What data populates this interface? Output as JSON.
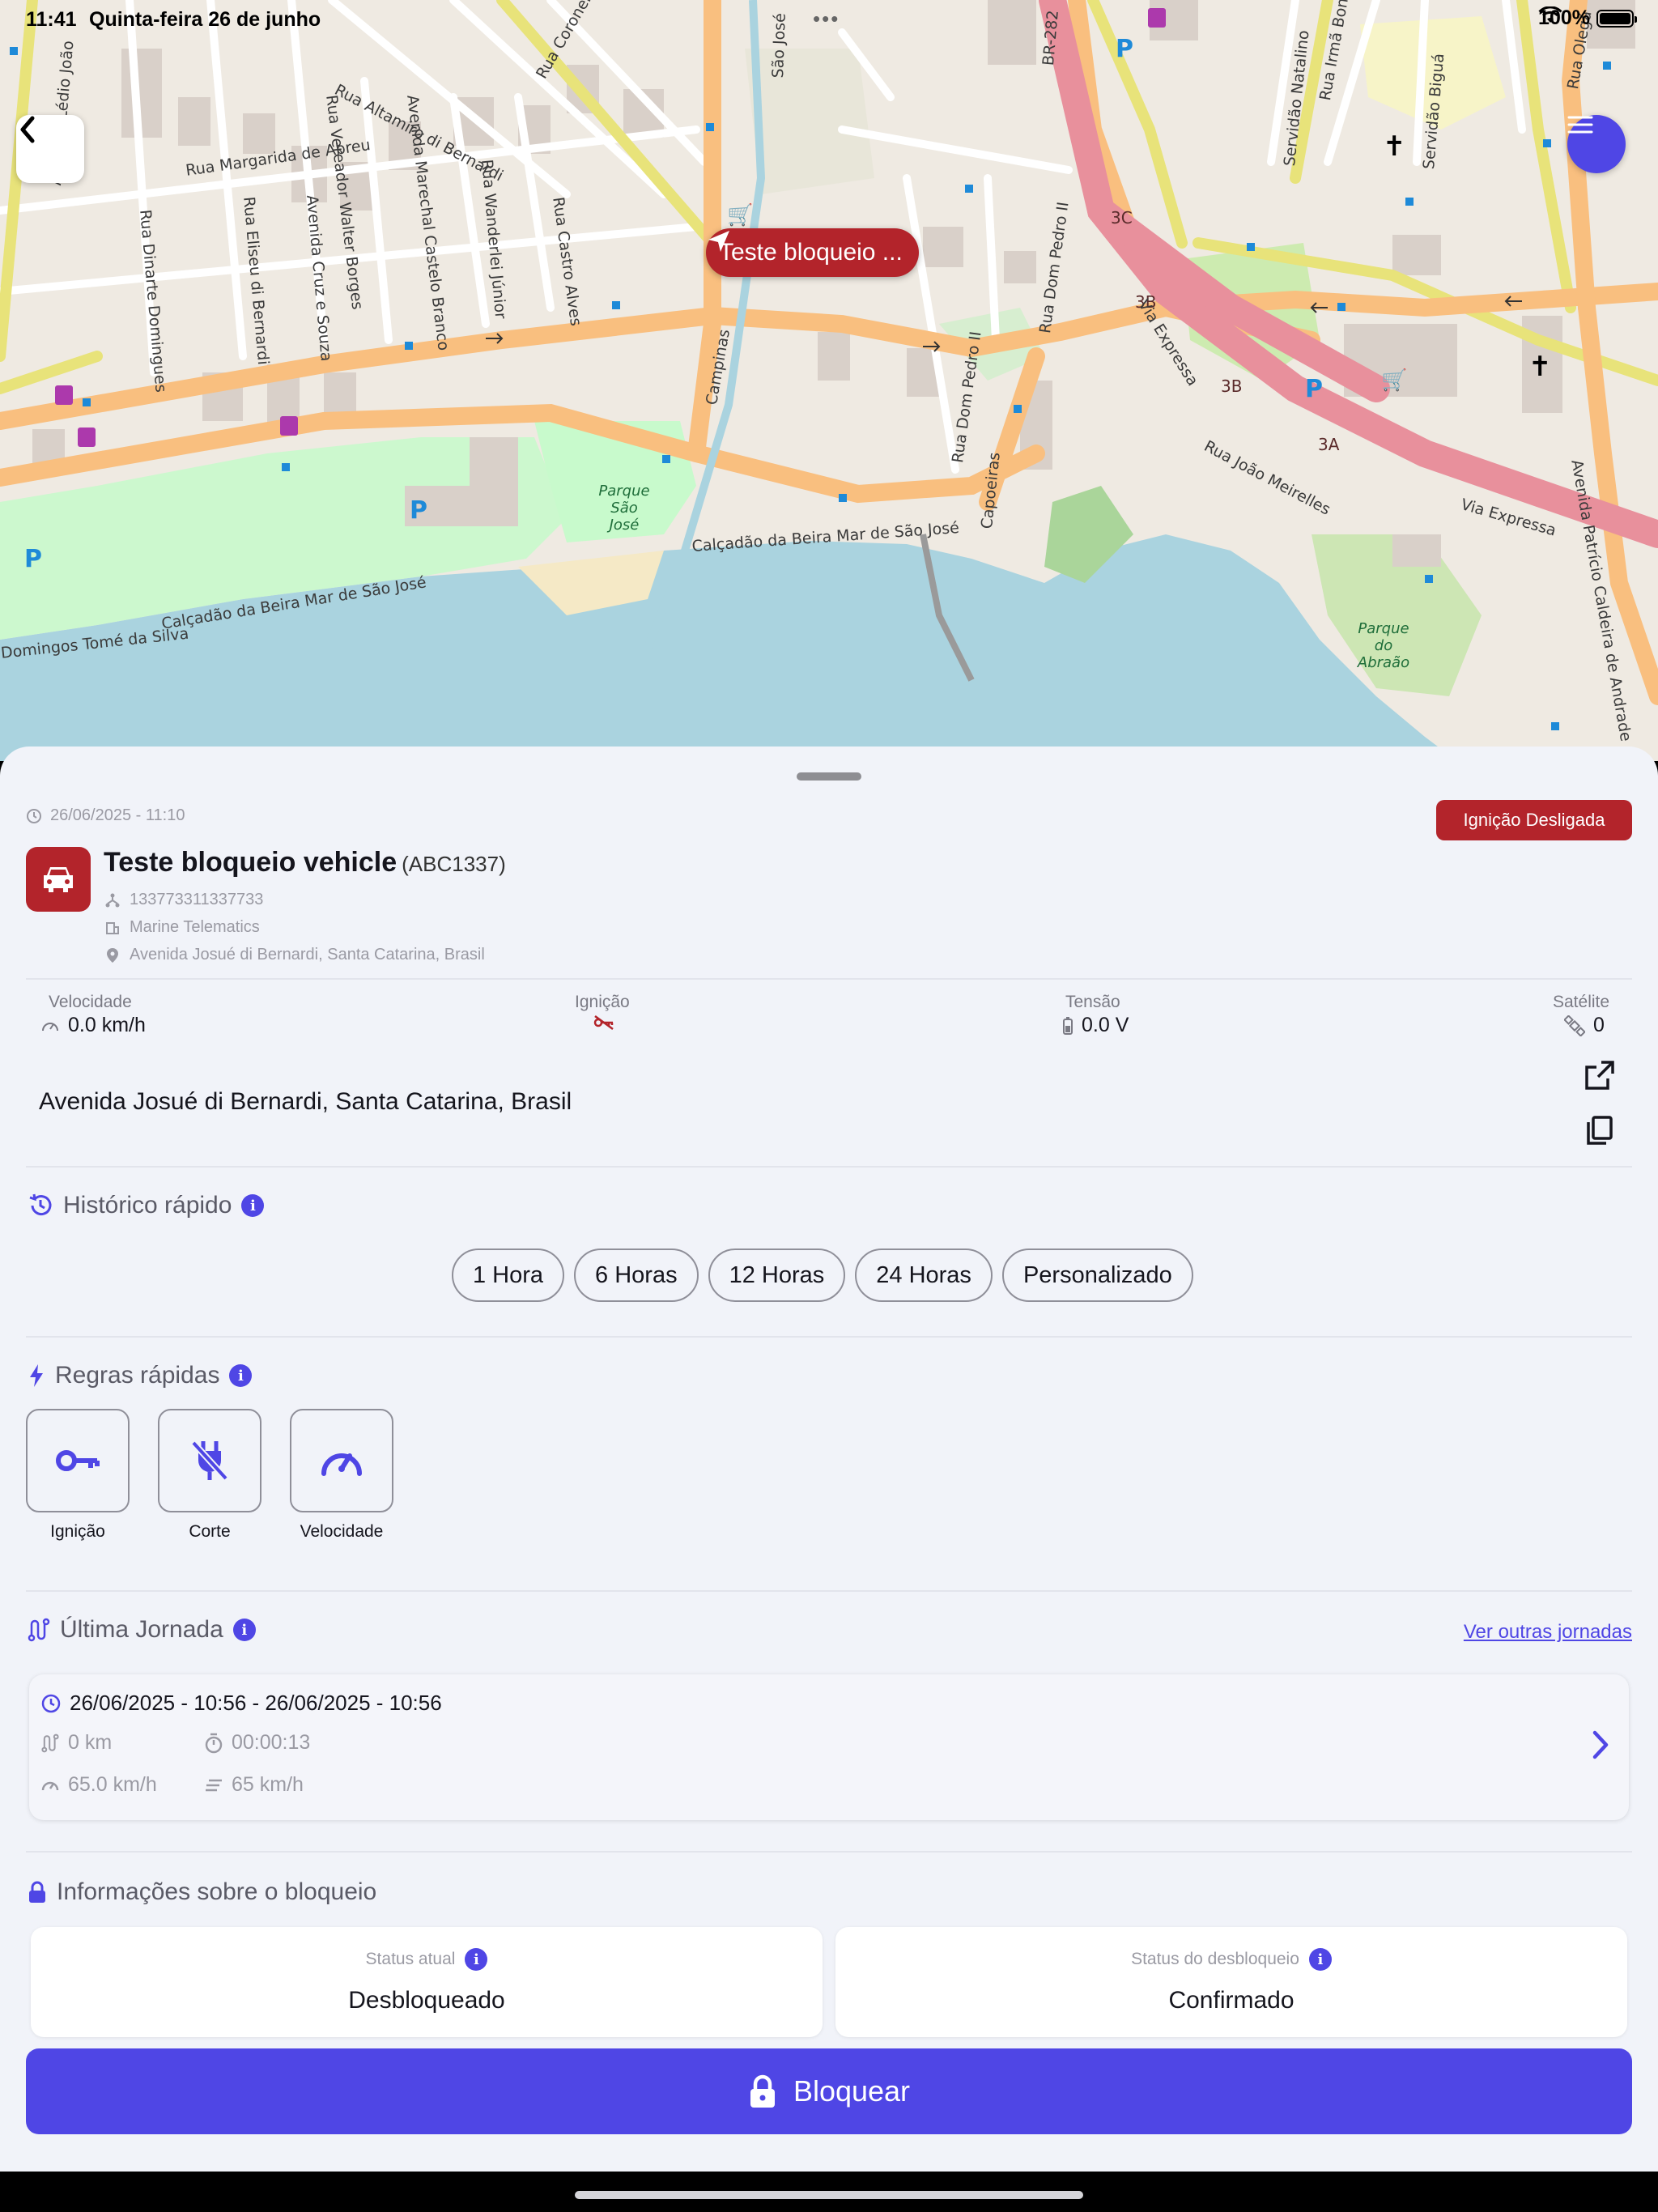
{
  "status_bar": {
    "time": "11:41",
    "date": "Quinta-feira 26 de junho",
    "battery": "100%"
  },
  "map": {
    "marker_label": "Teste bloqueio ...",
    "street_labels": [
      "Rua Altamiro di Bernardi",
      "Rua Margarida de Abreu",
      "Rua Vereador Walter Borges",
      "Avenida Marechal Castelo Branco",
      "Rua Wanderlei Júnior",
      "Rua Castro Alves",
      "Rua Coronel",
      "Rua Eliseu di Bernardi",
      "Avenida Cruz e Souza",
      "Rua Dinarte Domingues",
      "Avenida Lédio João",
      "Via Expressa",
      "Rua João Meirelles",
      "Rua Dom Pedro II",
      "Campinas",
      "São José",
      "Capoeiras",
      "Servidão Natalino",
      "Rua Irmã Bona",
      "Servidão Biguá",
      "Rua Olegá",
      "BR-282",
      "Avenida Patrício Caldeira de Andrade",
      "Calçadão da Beira Mar de São José",
      "Domingos Tomé da Silva"
    ],
    "park_labels": [
      "Parque São José",
      "Parque do Abraão"
    ],
    "exit_labels": [
      "3C",
      "3B",
      "3B",
      "3A"
    ]
  },
  "vehicle": {
    "timestamp": "26/06/2025 - 11:10",
    "ignition_badge": "Ignição Desligada",
    "name": "Teste bloqueio vehicle",
    "plate": "(ABC1337)",
    "device_id": "133773311337733",
    "company": "Marine Telematics",
    "location": "Avenida Josué di Bernardi, Santa Catarina, Brasil"
  },
  "metrics": {
    "speed_label": "Velocidade",
    "speed_value": "0.0 km/h",
    "ignition_label": "Ignição",
    "voltage_label": "Tensão",
    "voltage_value": "0.0 V",
    "satellite_label": "Satélite",
    "satellite_value": "0"
  },
  "address": "Avenida Josué di Bernardi, Santa Catarina, Brasil",
  "quick_history": {
    "title": "Histórico rápido",
    "chips": [
      "1 Hora",
      "6 Horas",
      "12 Horas",
      "24 Horas",
      "Personalizado"
    ]
  },
  "quick_rules": {
    "title": "Regras rápidas",
    "items": [
      "Ignição",
      "Corte",
      "Velocidade"
    ]
  },
  "last_journey": {
    "title": "Última Jornada",
    "link": "Ver outras jornadas",
    "period": "26/06/2025 - 10:56 - 26/06/2025 - 10:56",
    "distance": "0 km",
    "duration": "00:00:13",
    "max_speed": "65.0 km/h",
    "avg_speed": "65 km/h"
  },
  "block_info": {
    "title": "Informações sobre o bloqueio",
    "status_label": "Status atual",
    "status_value": "Desbloqueado",
    "unlock_label": "Status do desbloqueio",
    "unlock_value": "Confirmado",
    "button": "Bloquear"
  },
  "colors": {
    "accent": "#4f46e5",
    "danger": "#b3242b",
    "sheet_bg": "#f1f3f9"
  }
}
